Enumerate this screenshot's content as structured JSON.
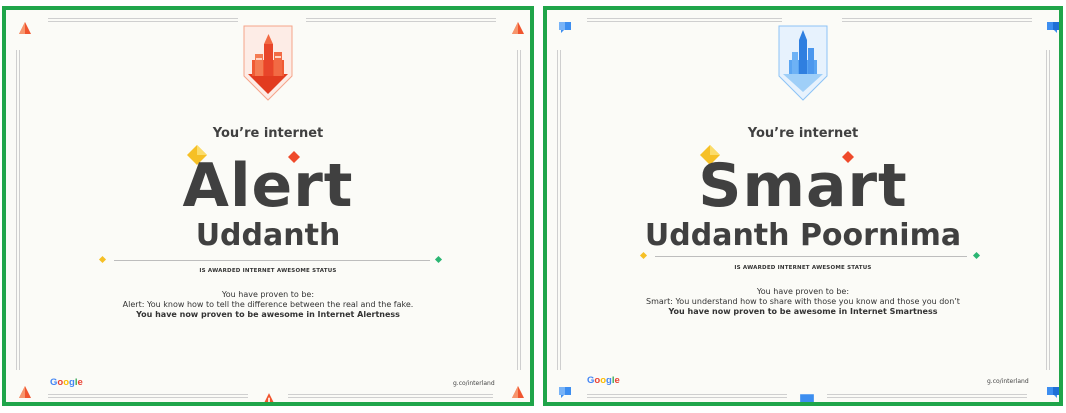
{
  "certificates": [
    {
      "heading": "You’re internet",
      "quality": "Alert",
      "name": "Uddanth",
      "status": "IS AWARDED INTERNET AWESOME STATUS",
      "proven_intro": "You have proven to be:",
      "proven_detail": "Alert: You know how to tell the difference between the real and the fake.",
      "proven_summary": "You have now proven to be awesome in Internet Alertness",
      "brand": "Google",
      "url": "g.co/interland",
      "accent": "#ef4a2b",
      "badge_icon": "red-tower-badge-icon",
      "corner_icon": "red-triangle-icon"
    },
    {
      "heading": "You’re internet",
      "quality": "Smart",
      "name": "Uddanth Poornima",
      "status": "IS AWARDED INTERNET AWESOME STATUS",
      "proven_intro": "You have proven to be:",
      "proven_detail": "Smart: You understand how to share with those you know and those you don’t",
      "proven_summary": "You have now proven to be awesome in Internet Smartness",
      "brand": "Google",
      "url": "g.co/interland",
      "accent": "#3d8ef0",
      "badge_icon": "blue-tower-badge-icon",
      "corner_icon": "blue-speech-bubble-icon"
    }
  ],
  "frame_color": "#1fa54a"
}
